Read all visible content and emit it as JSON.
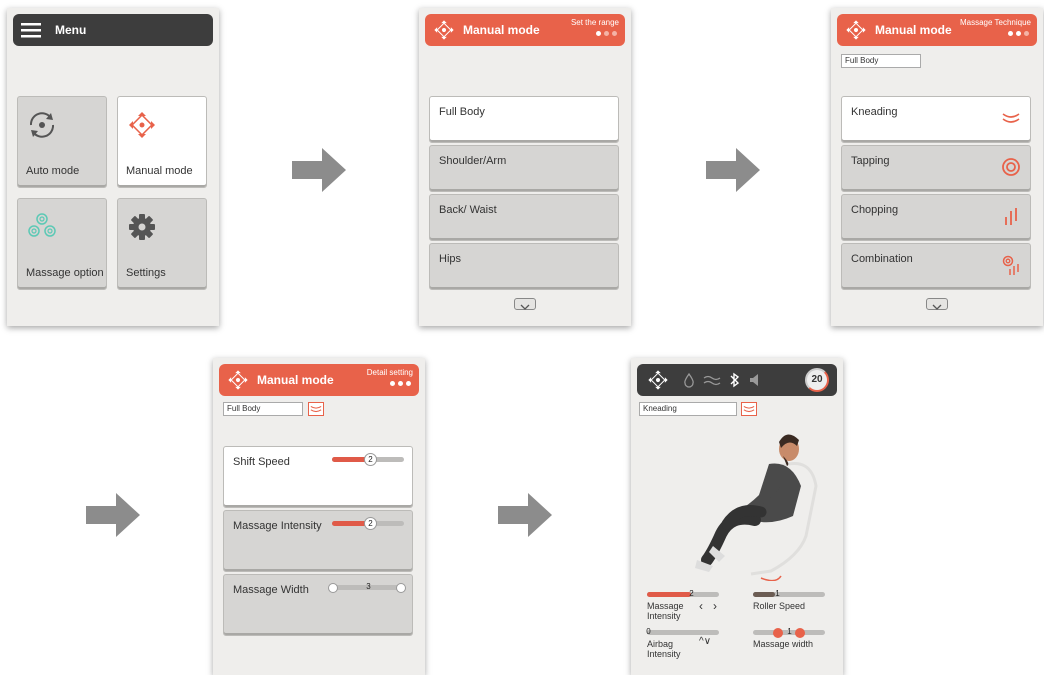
{
  "screen1": {
    "header": {
      "title": "Menu",
      "icon": "hamburger-menu-icon"
    },
    "tiles": [
      {
        "label": "Auto mode",
        "icon": "refresh-icon"
      },
      {
        "label": "Manual mode",
        "icon": "directional-pad-icon"
      },
      {
        "label": "Massage option",
        "icon": "massage-balls-icon"
      },
      {
        "label": "Settings",
        "icon": "gear-icon"
      }
    ]
  },
  "screen2": {
    "header": {
      "title": "Manual mode",
      "step": "Set the range"
    },
    "items": [
      "Full Body",
      "Shoulder/Arm",
      "Back/ Waist",
      "Hips"
    ]
  },
  "screen3": {
    "header": {
      "title": "Manual mode",
      "step": "Massage Technique"
    },
    "range_field": "Full Body",
    "items": [
      {
        "label": "Kneading",
        "icon": "kneading-icon"
      },
      {
        "label": "Tapping",
        "icon": "tapping-icon"
      },
      {
        "label": "Chopping",
        "icon": "chopping-icon"
      },
      {
        "label": "Combination",
        "icon": "combination-icon"
      }
    ]
  },
  "screen4": {
    "header": {
      "title": "Manual mode",
      "step": "Detail setting"
    },
    "range_field": "Full Body",
    "settings": [
      {
        "label": "Shift Speed",
        "value": "2",
        "level": 0.5
      },
      {
        "label": "Massage Intensity",
        "value": "2",
        "level": 0.5
      },
      {
        "label": "Massage Width",
        "value": "3",
        "level": 0.5
      }
    ]
  },
  "screen5": {
    "timer": "20",
    "technique_field": "Kneading",
    "controls": {
      "massage_intensity": {
        "label": "Massage Intensity",
        "value": "2",
        "level": 0.5
      },
      "roller_speed": {
        "label": "Roller Speed",
        "value": "1",
        "level": 0.33
      },
      "airbag_intensity": {
        "label": "Airbag Intensity",
        "value": "0",
        "level": 0
      },
      "massage_width": {
        "label": "Massage width",
        "value": "1"
      }
    }
  },
  "colors": {
    "accent": "#e8624a",
    "dark_header": "#3d3d3d",
    "tile": "#d6d5d3",
    "teal": "#5cc9b5",
    "arrow": "#8c8c8c"
  }
}
